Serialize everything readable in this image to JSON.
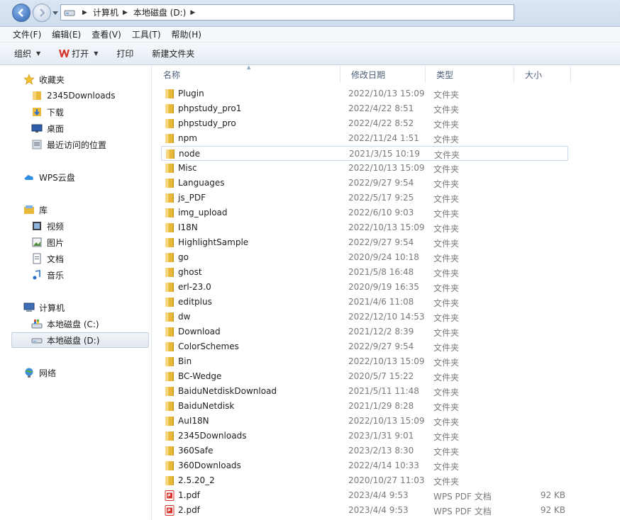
{
  "address": {
    "crumbs": [
      "计算机",
      "本地磁盘 (D:)"
    ]
  },
  "menu": [
    "文件(F)",
    "编辑(E)",
    "查看(V)",
    "工具(T)",
    "帮助(H)"
  ],
  "toolbar": {
    "organize": "组织",
    "open": "打开",
    "print": "打印",
    "new_folder": "新建文件夹"
  },
  "sidebar": {
    "favorites": "收藏夹",
    "fav_items": [
      "2345Downloads",
      "下载",
      "桌面",
      "最近访问的位置"
    ],
    "wps": "WPS云盘",
    "library": "库",
    "lib_items": [
      "视频",
      "图片",
      "文档",
      "音乐"
    ],
    "computer": "计算机",
    "drives": [
      "本地磁盘 (C:)",
      "本地磁盘 (D:)"
    ],
    "network": "网络"
  },
  "columns": {
    "name": "名称",
    "modified": "修改日期",
    "type": "类型",
    "size": "大小"
  },
  "files": [
    {
      "name": "Plugin",
      "date": "2022/10/13 15:09",
      "type": "文件夹",
      "size": ""
    },
    {
      "name": "phpstudy_pro1",
      "date": "2022/4/22 8:51",
      "type": "文件夹",
      "size": ""
    },
    {
      "name": "phpstudy_pro",
      "date": "2022/4/22 8:52",
      "type": "文件夹",
      "size": ""
    },
    {
      "name": "npm",
      "date": "2022/11/24 1:51",
      "type": "文件夹",
      "size": ""
    },
    {
      "name": "node",
      "date": "2021/3/15 10:19",
      "type": "文件夹",
      "size": ""
    },
    {
      "name": "Misc",
      "date": "2022/10/13 15:09",
      "type": "文件夹",
      "size": ""
    },
    {
      "name": "Languages",
      "date": "2022/9/27 9:54",
      "type": "文件夹",
      "size": ""
    },
    {
      "name": "js_PDF",
      "date": "2022/5/17 9:25",
      "type": "文件夹",
      "size": ""
    },
    {
      "name": "img_upload",
      "date": "2022/6/10 9:03",
      "type": "文件夹",
      "size": ""
    },
    {
      "name": "I18N",
      "date": "2022/10/13 15:09",
      "type": "文件夹",
      "size": ""
    },
    {
      "name": "HighlightSample",
      "date": "2022/9/27 9:54",
      "type": "文件夹",
      "size": ""
    },
    {
      "name": "go",
      "date": "2020/9/24 10:18",
      "type": "文件夹",
      "size": ""
    },
    {
      "name": "ghost",
      "date": "2021/5/8 16:48",
      "type": "文件夹",
      "size": ""
    },
    {
      "name": "erl-23.0",
      "date": "2020/9/19 16:35",
      "type": "文件夹",
      "size": ""
    },
    {
      "name": "editplus",
      "date": "2021/4/6 11:08",
      "type": "文件夹",
      "size": ""
    },
    {
      "name": "dw",
      "date": "2022/12/10 14:53",
      "type": "文件夹",
      "size": ""
    },
    {
      "name": "Download",
      "date": "2021/12/2 8:39",
      "type": "文件夹",
      "size": ""
    },
    {
      "name": "ColorSchemes",
      "date": "2022/9/27 9:54",
      "type": "文件夹",
      "size": ""
    },
    {
      "name": "Bin",
      "date": "2022/10/13 15:09",
      "type": "文件夹",
      "size": ""
    },
    {
      "name": "BC-Wedge",
      "date": "2020/5/7 15:22",
      "type": "文件夹",
      "size": ""
    },
    {
      "name": "BaiduNetdiskDownload",
      "date": "2021/5/11 11:48",
      "type": "文件夹",
      "size": ""
    },
    {
      "name": "BaiduNetdisk",
      "date": "2021/1/29 8:28",
      "type": "文件夹",
      "size": ""
    },
    {
      "name": "AuI18N",
      "date": "2022/10/13 15:09",
      "type": "文件夹",
      "size": ""
    },
    {
      "name": "2345Downloads",
      "date": "2023/1/31 9:01",
      "type": "文件夹",
      "size": ""
    },
    {
      "name": "360Safe",
      "date": "2023/2/13 8:30",
      "type": "文件夹",
      "size": ""
    },
    {
      "name": "360Downloads",
      "date": "2022/4/14 10:33",
      "type": "文件夹",
      "size": ""
    },
    {
      "name": "2.5.20_2",
      "date": "2020/10/27 11:03",
      "type": "文件夹",
      "size": ""
    },
    {
      "name": "1.pdf",
      "date": "2023/4/4 9:53",
      "type": "WPS PDF 文档",
      "size": "92 KB"
    },
    {
      "name": "2.pdf",
      "date": "2023/4/4 9:53",
      "type": "WPS PDF 文档",
      "size": "92 KB"
    }
  ],
  "colors": {
    "folder": "#e8b93a",
    "pdf": "#d9302a",
    "selection_border": "#c9d8ec"
  }
}
